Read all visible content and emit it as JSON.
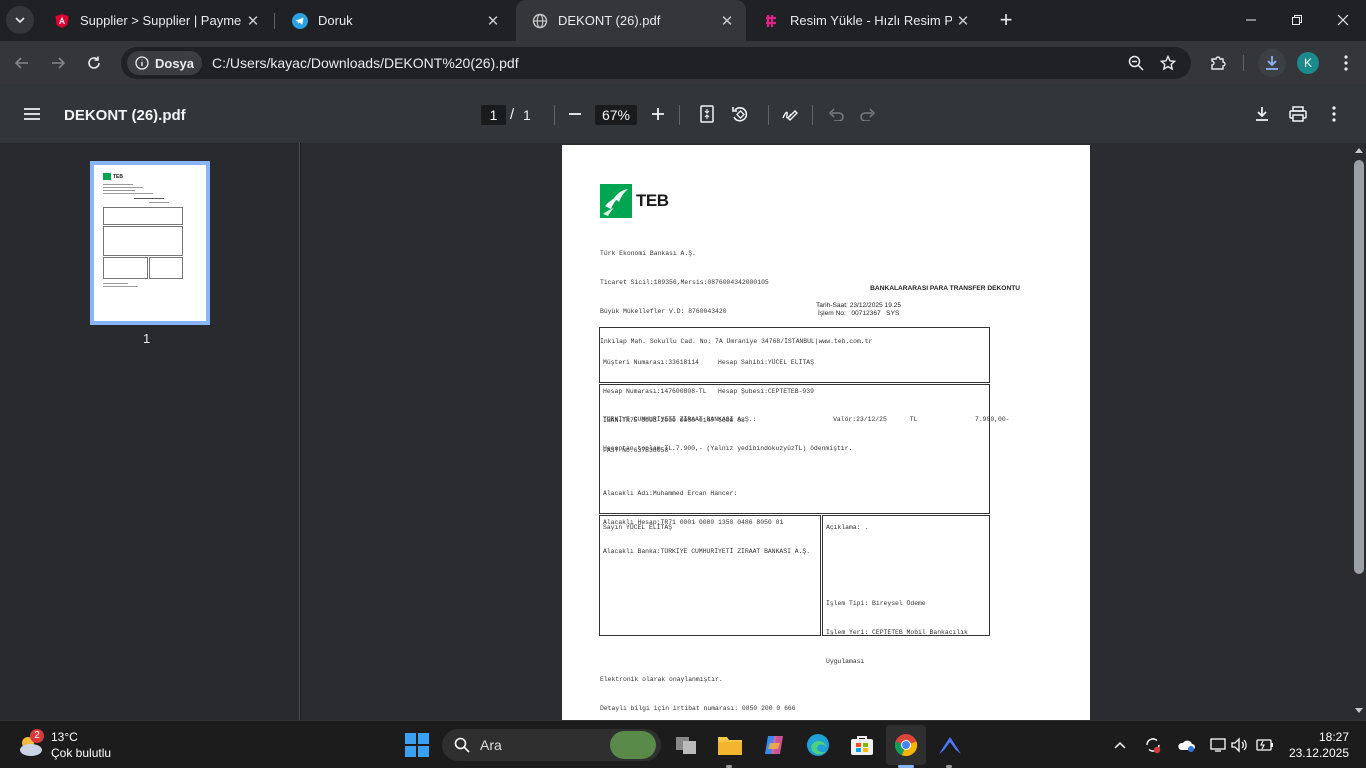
{
  "browser": {
    "tabs": [
      {
        "title": "Supplier > Supplier | Payment C",
        "icon": "angular-icon",
        "active": false
      },
      {
        "title": "Doruk",
        "icon": "telegram-icon",
        "active": false
      },
      {
        "title": "DEKONT (26).pdf",
        "icon": "globe-icon",
        "active": true
      },
      {
        "title": "Resim Yükle - Hızlı Resim Paylaş",
        "icon": "resim-icon",
        "active": false
      }
    ],
    "new_tab_label": "+",
    "omnibox": {
      "chip": "Dosya",
      "url": "C:/Users/kayac/Downloads/DEKONT%20(26).pdf"
    },
    "profile_initial": "K"
  },
  "pdf": {
    "title": "DEKONT (26).pdf",
    "page_current": "1",
    "page_sep": "/",
    "page_total": "1",
    "zoom": "67%",
    "thumb_label": "1"
  },
  "doc": {
    "logo_text": "TEB",
    "header_lines": [
      "Türk Ekonomi Bankası A.Ş.",
      "Ticaret Sicil:189356,Mersis:0876004342000105",
      "Büyük Mükellefler V.D: 8760043420",
      "İnkılap Mah. Sokullu Cad. No: 7A Ümraniye 34768/İSTANBUL|www.teb.com.tr"
    ],
    "doc_title": "BANKALARARASI PARA TRANSFER DEKONTU",
    "date_line": "Tarih-Saat: 23/12/2025 19.25",
    "txn_line": "İşlem No:   00712367   SYS",
    "box1": [
      "Müşteri Numarası:33618114     Hesap Sahibi:YÜCEL ELİTAŞ",
      "Hesap Numarası:147600808-TL   Hesap Şubesi:CEPTETEB-939",
      "IBAN:TR75 0003 2000 0000 0147 6008 08",
      "FAST No:637838058"
    ],
    "box2_top": [
      "TÜRKİYE CUMHURİYETİ ZİRAAT BANKASI A.Ş.:                    Valör:23/12/25      TL               7.900,00-",
      "Hesaptan toplam TL.7.900,- (Yalnız yedibindokuzyüzTL) ödenmiştir."
    ],
    "box2_bottom": [
      "Alacaklı Adı:Muhammed Ercan Hancer:",
      "Alacaklı Hesap:TR71 0001 0080 1350 0486 8050 01",
      "Alacaklı Banka:TÜRKİYE CUMHURİYETİ ZİRAAT BANKASI A.Ş."
    ],
    "box3_left": "Sayın YÜCEL ELİTAŞ",
    "box3_right_top": "Açıklama: .",
    "box3_right_bottom": [
      "İşlem Tipi: Bireysel Ödeme",
      "İşlem Yeri: CEPTETEB Mobil Bankacılık",
      "Uygulaması"
    ],
    "footer": [
      "Elektronik olarak onaylanmıştır.",
      "Detaylı bilgi için irtibat numarası: 0850 200 0 666"
    ]
  },
  "taskbar": {
    "weather_temp": "13°C",
    "weather_desc": "Çok bulutlu",
    "weather_badge": "2",
    "search_placeholder": "Ara",
    "time": "18:27",
    "date": "23.12.2025"
  },
  "colors": {
    "accent": "#8ab4f8",
    "teb_green": "#00a551",
    "chrome_bg": "#202124"
  }
}
